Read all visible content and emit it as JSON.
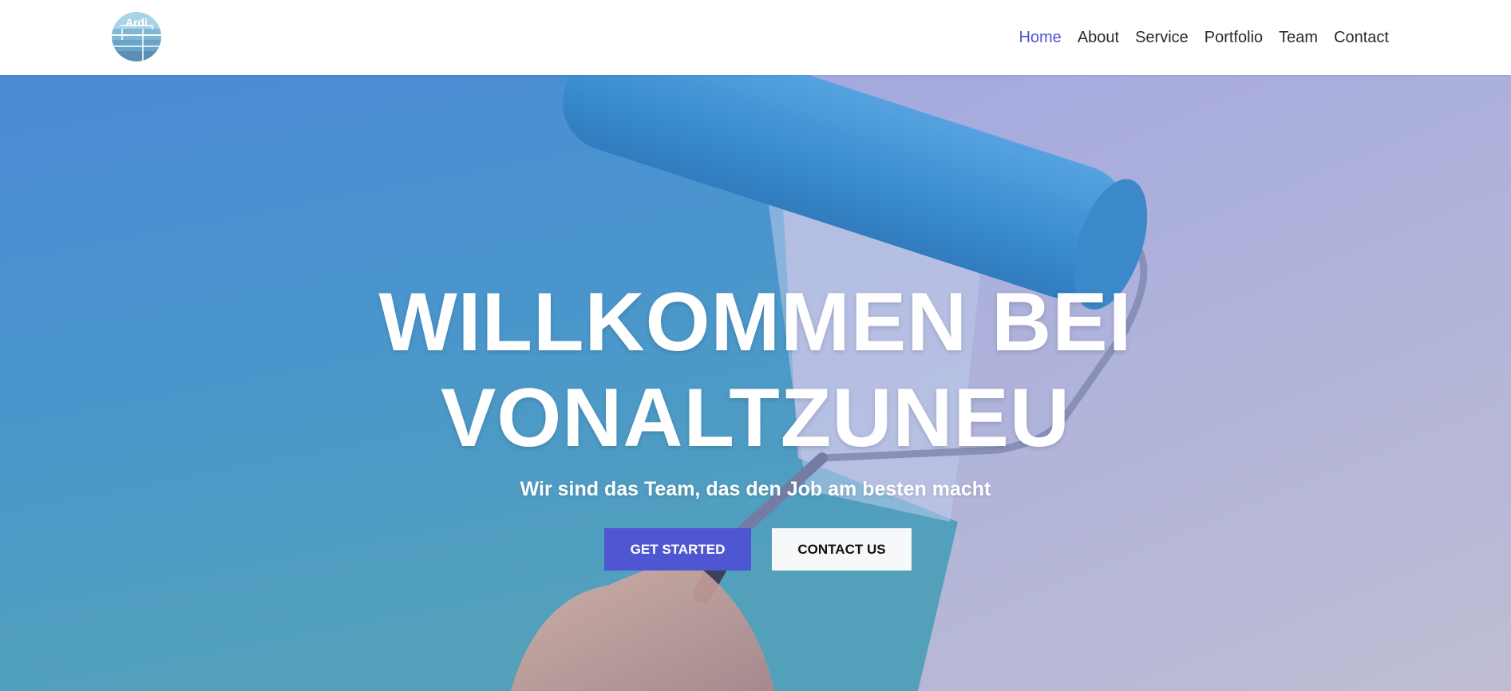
{
  "brand": {
    "logo_text": "Ardi",
    "logo_icon": "ardi-logo-icon"
  },
  "nav": {
    "items": [
      {
        "label": "Home",
        "active": true
      },
      {
        "label": "About",
        "active": false
      },
      {
        "label": "Service",
        "active": false
      },
      {
        "label": "Portfolio",
        "active": false
      },
      {
        "label": "Team",
        "active": false
      },
      {
        "label": "Contact",
        "active": false
      }
    ]
  },
  "hero": {
    "title_line1": "WILLKOMMEN BEI",
    "title_line2": "VONALTZUNEU",
    "subtitle": "Wir sind das Team, das den Job am besten macht",
    "primary_button": "GET STARTED",
    "secondary_button": "CONTACT US",
    "background_image": "paint-roller-blue-wall-image"
  },
  "colors": {
    "accent": "#4f56d1",
    "nav_text": "#2b2b2b",
    "secondary_button_bg": "#f7f8fa"
  }
}
